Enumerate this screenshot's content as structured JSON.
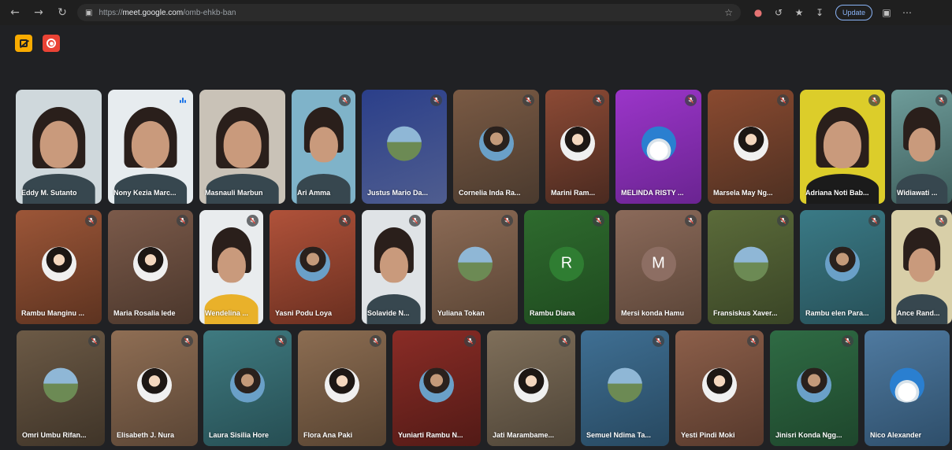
{
  "browser": {
    "url_prefix": "https://",
    "url_host": "meet.google.com",
    "url_path": "/omb-ehkb-ban",
    "update_label": "Update"
  },
  "colors": {
    "background": "#202124",
    "mute_badge": "#3c4043",
    "speaking": "#1a73e8",
    "ai_badge": "#f9ab00",
    "rec_badge": "#ea4335"
  },
  "participants": [
    {
      "name": "Eddy M. Sutanto",
      "muted": false,
      "speaking": false,
      "media": "video"
    },
    {
      "name": "Nony Kezia Marc...",
      "muted": false,
      "speaking": true,
      "media": "video"
    },
    {
      "name": "Masnauli Marbun",
      "muted": false,
      "speaking": false,
      "media": "video"
    },
    {
      "name": "Ari Amma",
      "muted": true,
      "speaking": false,
      "media": "video"
    },
    {
      "name": "Justus Mario Da...",
      "muted": true,
      "speaking": false,
      "media": "avatar"
    },
    {
      "name": "Cornelia Inda Ra...",
      "muted": true,
      "speaking": false,
      "media": "avatar"
    },
    {
      "name": "Marini Ram...",
      "muted": true,
      "speaking": false,
      "media": "avatar"
    },
    {
      "name": "MELINDA RISTY ...",
      "muted": true,
      "speaking": false,
      "media": "avatar"
    },
    {
      "name": "Marsela May Ng...",
      "muted": true,
      "speaking": false,
      "media": "avatar"
    },
    {
      "name": "Adriana Noti Bab...",
      "muted": true,
      "speaking": false,
      "media": "video"
    },
    {
      "name": "Widiawati ...",
      "muted": true,
      "speaking": false,
      "media": "video"
    },
    {
      "name": "Rambu Manginu ...",
      "muted": true,
      "speaking": false,
      "media": "avatar"
    },
    {
      "name": "Maria Rosalia lede",
      "muted": true,
      "speaking": false,
      "media": "avatar"
    },
    {
      "name": "Wendelina ...",
      "muted": true,
      "speaking": false,
      "media": "video"
    },
    {
      "name": "Yasni Podu Loya",
      "muted": true,
      "speaking": false,
      "media": "avatar"
    },
    {
      "name": "Solavide N...",
      "muted": true,
      "speaking": false,
      "media": "video"
    },
    {
      "name": "Yuliana Tokan",
      "muted": true,
      "speaking": false,
      "media": "avatar"
    },
    {
      "name": "Rambu Diana",
      "muted": true,
      "speaking": false,
      "media": "letter",
      "initial": "R"
    },
    {
      "name": "Mersi konda Hamu",
      "muted": true,
      "speaking": false,
      "media": "letter",
      "initial": "M"
    },
    {
      "name": "Fransiskus Xaver...",
      "muted": true,
      "speaking": false,
      "media": "avatar"
    },
    {
      "name": "Rambu elen Para...",
      "muted": true,
      "speaking": false,
      "media": "avatar"
    },
    {
      "name": "Ance Rand...",
      "muted": true,
      "speaking": false,
      "media": "video"
    },
    {
      "name": "Omri Umbu Rifan...",
      "muted": true,
      "speaking": false,
      "media": "avatar"
    },
    {
      "name": "Elisabeth J. Nura",
      "muted": true,
      "speaking": false,
      "media": "avatar"
    },
    {
      "name": "Laura Sisilia Hore",
      "muted": true,
      "speaking": false,
      "media": "avatar"
    },
    {
      "name": "Flora Ana Paki",
      "muted": true,
      "speaking": false,
      "media": "avatar"
    },
    {
      "name": "Yuniarti Rambu N...",
      "muted": true,
      "speaking": false,
      "media": "avatar"
    },
    {
      "name": "Jati Marambame...",
      "muted": true,
      "speaking": false,
      "media": "avatar"
    },
    {
      "name": "Semuel Ndima Ta...",
      "muted": true,
      "speaking": false,
      "media": "avatar"
    },
    {
      "name": "Yesti Pindi Moki",
      "muted": true,
      "speaking": false,
      "media": "avatar"
    },
    {
      "name": "Jinisri Konda Ngg...",
      "muted": true,
      "speaking": false,
      "media": "avatar"
    },
    {
      "name": "Nico Alexander",
      "muted": false,
      "speaking": false,
      "media": "avatar"
    }
  ]
}
